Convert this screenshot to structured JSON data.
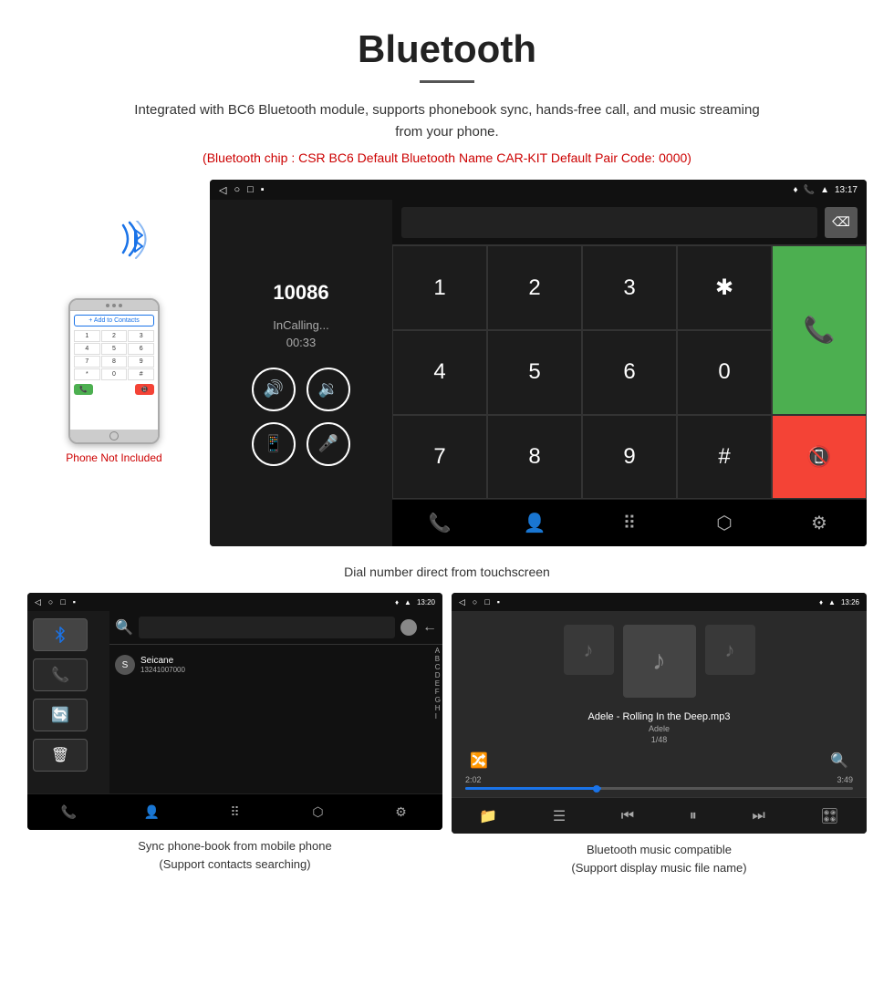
{
  "header": {
    "title": "Bluetooth",
    "subtitle": "Integrated with BC6 Bluetooth module, supports phonebook sync, hands-free call, and music streaming from your phone.",
    "spec_line": "(Bluetooth chip : CSR BC6    Default Bluetooth Name CAR-KIT    Default Pair Code: 0000)"
  },
  "phone_mockup": {
    "not_included": "Phone Not Included",
    "contact_btn": "+ Add to Contacts",
    "keys": [
      "1",
      "2",
      "3",
      "4",
      "5",
      "6",
      "7",
      "8",
      "9",
      "*",
      "0",
      "#"
    ]
  },
  "dial_screen": {
    "time": "13:17",
    "number": "10086",
    "status": "InCalling...",
    "timer": "00:33",
    "keys": [
      "1",
      "2",
      "3",
      "*",
      "4",
      "5",
      "6",
      "0",
      "7",
      "8",
      "9",
      "#"
    ]
  },
  "dial_caption": "Dial number direct from touchscreen",
  "phonebook_screen": {
    "time": "13:20",
    "contact_name": "Seicane",
    "contact_number": "13241007000",
    "alpha_letters": [
      "A",
      "B",
      "C",
      "D",
      "E",
      "F",
      "G",
      "H",
      "I"
    ]
  },
  "phonebook_caption": "Sync phone-book from mobile phone\n(Support contacts searching)",
  "music_screen": {
    "time": "13:26",
    "song": "Adele - Rolling In the Deep.mp3",
    "artist": "Adele",
    "track": "1/48",
    "time_current": "2:02",
    "time_total": "3:49"
  },
  "music_caption": "Bluetooth music compatible\n(Support display music file name)",
  "colors": {
    "accent_green": "#4CAF50",
    "accent_red": "#f44336",
    "accent_blue": "#1a73e8",
    "spec_red": "#cc0000"
  }
}
